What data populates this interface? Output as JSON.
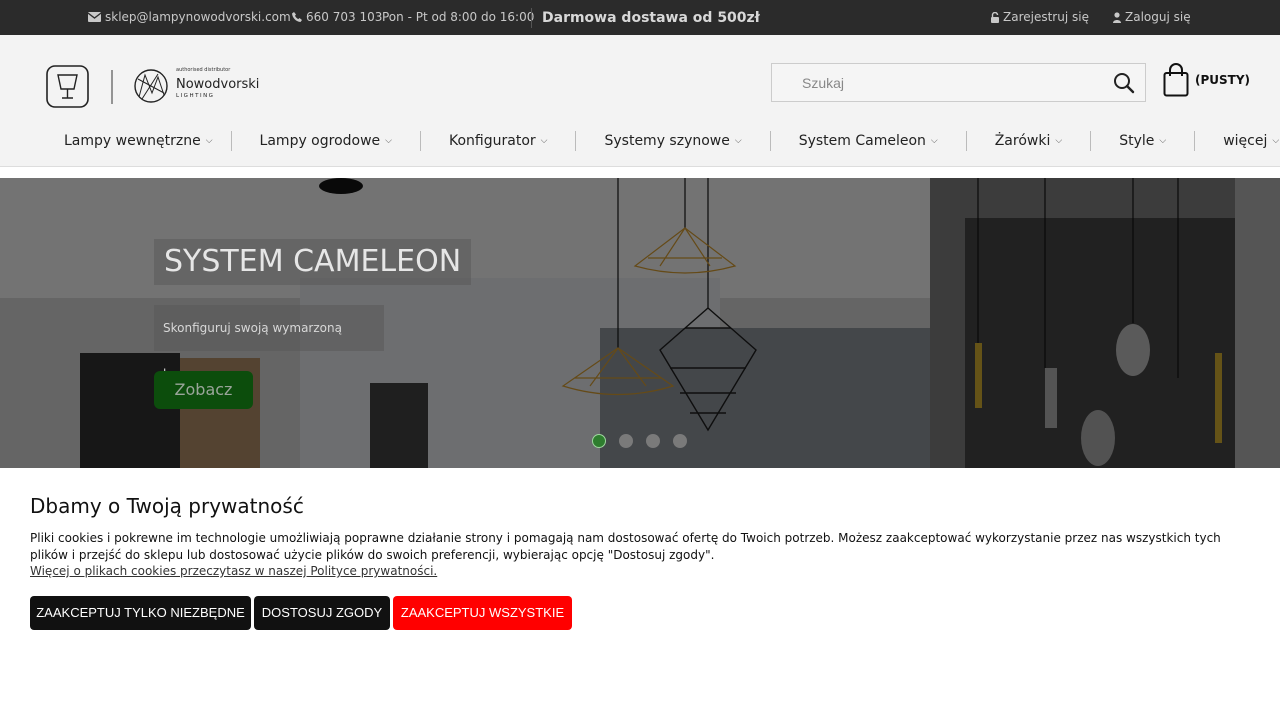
{
  "topbar": {
    "email": "sklep@lampynowodvorski.com",
    "phone": "660 703 103",
    "hours": "Pon - Pt od 8:00 do 16:00",
    "promo": "Darmowa dostawa od 500zł",
    "register": "Zarejestruj się",
    "login": "Zaloguj się"
  },
  "header": {
    "logo_distributor": "authorised distributor",
    "logo_brand": "Nowodvorski",
    "logo_sub": "LIGHTING",
    "search_placeholder": "Szukaj",
    "cart_label": "(PUSTY)"
  },
  "nav": {
    "items": [
      {
        "label": "Lampy wewnętrzne"
      },
      {
        "label": "Lampy ogrodowe"
      },
      {
        "label": "Konfigurator"
      },
      {
        "label": "Systemy szynowe"
      },
      {
        "label": "System Cameleon"
      },
      {
        "label": "Żarówki"
      },
      {
        "label": "Style"
      },
      {
        "label": "więcej"
      }
    ]
  },
  "hero": {
    "title": "SYSTEM CAMELEON",
    "subtitle": "Skonfiguruj swoją wymarzoną lampę",
    "button": "Zobacz",
    "active_slide": 1,
    "slide_count": 4
  },
  "cookie": {
    "title": "Dbamy o Twoją prywatność",
    "text": "Pliki cookies i pokrewne im technologie umożliwiają poprawne działanie strony i pomagają nam dostosować ofertę do Twoich potrzeb. Możesz zaakceptować wykorzystanie przez nas wszystkich tych plików i przejść do sklepu lub dostosować użycie plików do swoich preferencji, wybierając opcję \"Dostosuj zgody\".",
    "link": "Więcej o plikach cookies przeczytasz w naszej Polityce prywatności.",
    "btn_necessary": "ZAAKCEPTUJ TYLKO NIEZBĘDNE",
    "btn_customize": "DOSTOSUJ ZGODY",
    "btn_accept_all": "ZAAKCEPTUJ WSZYSTKIE"
  },
  "colors": {
    "topbar_bg": "#2b2b2b",
    "hero_button": "#0c4d0c",
    "accept_all": "#ff0000",
    "dark_button": "#111111"
  }
}
